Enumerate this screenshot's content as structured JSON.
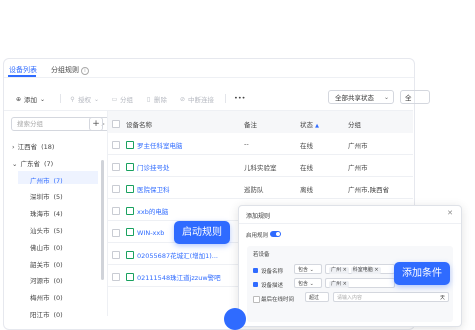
{
  "tabs": [
    {
      "label": "设备列表",
      "active": true
    },
    {
      "label": "分组规则",
      "active": false
    }
  ],
  "toolbar": {
    "add": "添加",
    "authorize": "授权",
    "group": "分组",
    "delete": "删除",
    "disconnect": "中断连接",
    "more": "•••",
    "status_select": "全部共享状态",
    "status_select2": "全"
  },
  "sidebar": {
    "search_placeholder": "搜索分组",
    "add_label": "+",
    "tree": [
      {
        "label": "江西省",
        "count": "(18)",
        "level": 0,
        "expand": "›"
      },
      {
        "label": "广东省",
        "count": "(7)",
        "level": 0,
        "expand": "⌄"
      },
      {
        "label": "广州市",
        "count": "(7)",
        "level": 1,
        "selected": true
      },
      {
        "label": "深圳市",
        "count": "(5)",
        "level": 1
      },
      {
        "label": "珠海市",
        "count": "(4)",
        "level": 1
      },
      {
        "label": "汕头市",
        "count": "(5)",
        "level": 1
      },
      {
        "label": "佛山市",
        "count": "(0)",
        "level": 1
      },
      {
        "label": "韶关市",
        "count": "(0)",
        "level": 1
      },
      {
        "label": "河源市",
        "count": "(0)",
        "level": 1
      },
      {
        "label": "梅州市",
        "count": "(0)",
        "level": 1
      },
      {
        "label": "阳江市",
        "count": "(0)",
        "level": 1
      }
    ]
  },
  "table": {
    "columns": [
      "设备名称",
      "备注",
      "状态",
      "分组"
    ],
    "rows": [
      {
        "name": "罗主任科室电脑",
        "note": "--",
        "status": "在线",
        "group": "广州市"
      },
      {
        "name": "门诊挂号处",
        "note": "儿科实验室",
        "status": "在线",
        "group": "广州市"
      },
      {
        "name": "医院保卫科",
        "note": "巡防队",
        "status": "离线",
        "group": "广州市,陕西省"
      },
      {
        "name": "xxb的电脑",
        "note": "",
        "status": "",
        "group": ""
      },
      {
        "name": "WIN-xxb",
        "note": "",
        "status": "",
        "group": ""
      },
      {
        "name": "02055687花城汇(增加1)...",
        "note": "",
        "status": "",
        "group": ""
      },
      {
        "name": "02111548珠江道jzzuw警吧",
        "note": "",
        "status": "",
        "group": ""
      }
    ]
  },
  "popup": {
    "title": "添加规则",
    "close": "✕",
    "enable_label": "启用规则",
    "section_label": "若设备",
    "conditions": [
      {
        "label": "设备名称",
        "op": "包含",
        "tags": [
          "广州",
          "科室电脑"
        ]
      },
      {
        "label": "设备描述",
        "op": "包含",
        "tags": [
          "广州"
        ]
      },
      {
        "label": "最后在线时间",
        "op": "超过",
        "value": "请输入内容",
        "unit": "天"
      }
    ]
  },
  "callouts": {
    "start_rule": "启动规则",
    "add_condition": "添加条件"
  },
  "colors": {
    "accent": "#2f6bff",
    "online": "#19a15f"
  }
}
